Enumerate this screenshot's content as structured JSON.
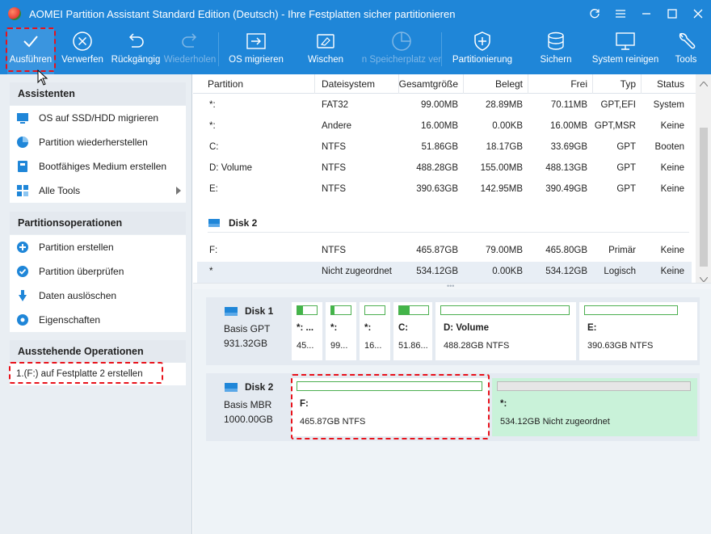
{
  "title": "AOMEI Partition Assistant Standard Edition (Deutsch) - Ihre Festplatten sicher partitionieren",
  "toolbar": {
    "apply": "Ausführen",
    "discard": "Verwerfen",
    "undo": "Rückgängig",
    "redo": "Wiederholen",
    "migrate_os": "OS migrieren",
    "wipe": "Wischen",
    "free_space": "n Speicherplatz ver",
    "partitioning": "Partitionierung",
    "backup": "Sichern",
    "clean": "System reinigen",
    "tools": "Tools"
  },
  "sidebar": {
    "wizards_title": "Assistenten",
    "wizards": [
      {
        "label": "OS auf SSD/HDD migrieren",
        "icon": "migrate-os-icon"
      },
      {
        "label": "Partition wiederherstellen",
        "icon": "recover-partition-icon"
      },
      {
        "label": "Bootfähiges Medium erstellen",
        "icon": "bootable-media-icon"
      },
      {
        "label": "Alle Tools",
        "icon": "all-tools-icon"
      }
    ],
    "ops_title": "Partitionsoperationen",
    "ops": [
      {
        "label": "Partition erstellen",
        "icon": "create-partition-icon"
      },
      {
        "label": "Partition überprüfen",
        "icon": "check-partition-icon"
      },
      {
        "label": "Daten auslöschen",
        "icon": "wipe-data-icon"
      },
      {
        "label": "Eigenschaften",
        "icon": "properties-icon"
      }
    ],
    "pending_title": "Ausstehende Operationen",
    "pending": [
      "1.(F:) auf Festplatte 2 erstellen"
    ]
  },
  "table": {
    "headers": [
      "Partition",
      "Dateisystem",
      "Gesamtgröße",
      "Belegt",
      "Frei",
      "Typ",
      "Status"
    ],
    "disk1_rows": [
      [
        "*:",
        "FAT32",
        "99.00MB",
        "28.89MB",
        "70.11MB",
        "GPT,EFI",
        "System"
      ],
      [
        "*:",
        "Andere",
        "16.00MB",
        "0.00KB",
        "16.00MB",
        "GPT,MSR",
        "Keine"
      ],
      [
        "C:",
        "NTFS",
        "51.86GB",
        "18.17GB",
        "33.69GB",
        "GPT",
        "Booten"
      ],
      [
        "D: Volume",
        "NTFS",
        "488.28GB",
        "155.00MB",
        "488.13GB",
        "GPT",
        "Keine"
      ],
      [
        "E:",
        "NTFS",
        "390.63GB",
        "142.95MB",
        "390.49GB",
        "GPT",
        "Keine"
      ]
    ],
    "disk2_label": "Disk 2",
    "disk2_rows": [
      [
        "F:",
        "NTFS",
        "465.87GB",
        "79.00MB",
        "465.80GB",
        "Primär",
        "Keine"
      ],
      [
        "*",
        "Nicht zugeordnet",
        "534.12GB",
        "0.00KB",
        "534.12GB",
        "Logisch",
        "Keine"
      ]
    ]
  },
  "disks": [
    {
      "name": "Disk 1",
      "type": "Basis GPT",
      "size": "931.32GB",
      "partitions": [
        {
          "label": "*: ...",
          "size": "45...",
          "used_fraction": 0.3
        },
        {
          "label": "*:",
          "size": "99...",
          "used_fraction": 0.15
        },
        {
          "label": "*:",
          "size": "16...",
          "used_fraction": 0.0
        },
        {
          "label": "C:",
          "size": "51.86...",
          "used_fraction": 0.35
        },
        {
          "label": "D: Volume",
          "size": "488.28GB NTFS",
          "used_fraction": 0.0
        },
        {
          "label": "E:",
          "size": "390.63GB NTFS",
          "used_fraction": 0.0
        }
      ]
    },
    {
      "name": "Disk 2",
      "type": "Basis MBR",
      "size": "1000.00GB",
      "partitions": [
        {
          "label": "F:",
          "size": "465.87GB NTFS",
          "used_fraction": 0.0
        },
        {
          "label": "*:",
          "size": "534.12GB Nicht zugeordnet",
          "used_fraction": 0.0
        }
      ]
    }
  ],
  "colors": {
    "accent": "#1f86d8",
    "used": "#43b549",
    "unallocated": "#c9f2d9",
    "highlight": "#e8121b"
  }
}
